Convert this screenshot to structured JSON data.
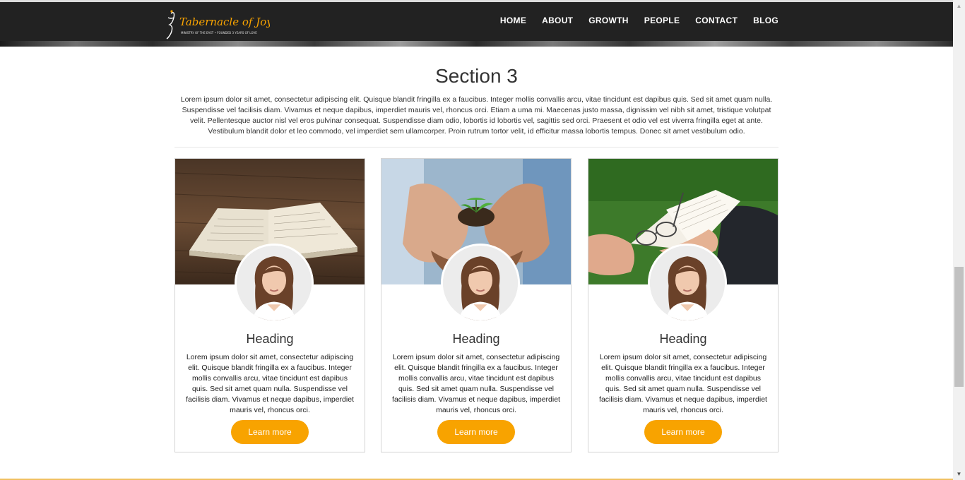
{
  "nav": {
    "logo_text": "Tabernacle of Joy",
    "logo_subtext": "Ministry of the East • Founded 3 years of love",
    "items": [
      "HOME",
      "ABOUT",
      "GROWTH",
      "PEOPLE",
      "CONTACT",
      "BLOG"
    ]
  },
  "section": {
    "title": "Section 3",
    "intro": "Lorem ipsum dolor sit amet, consectetur adipiscing elit. Quisque blandit fringilla ex a faucibus. Integer mollis convallis arcu, vitae tincidunt est dapibus quis. Sed sit amet quam nulla. Suspendisse vel facilisis diam. Vivamus et neque dapibus, imperdiet mauris vel, rhoncus orci. Etiam a uma mi. Maecenas justo massa, dignissim vel nibh sit amet, tristique volutpat velit. Pellentesque auctor nisl vel eros pulvinar consequat. Suspendisse diam odio, lobortis id lobortis vel, sagittis sed orci. Praesent et odio vel est viverra fringilla eget at ante. Vestibulum blandit dolor et leo commodo, vel imperdiet sem ullamcorper. Proin rutrum tortor velit, id efficitur massa lobortis tempus. Donec sit amet vestibulum odio."
  },
  "cards": [
    {
      "image": "open-bible-on-wood-photo",
      "heading": "Heading",
      "text": "Lorem ipsum dolor sit amet, consectetur adipiscing elit. Quisque blandit fringilla ex a faucibus. Integer mollis convallis arcu, vitae tincidunt est dapibus quis. Sed sit amet quam nulla. Suspendisse vel facilisis diam. Vivamus et neque dapibus, imperdiet mauris vel, rhoncus orci.",
      "button": "Learn more"
    },
    {
      "image": "hands-holding-seedling-photo",
      "heading": "Heading",
      "text": "Lorem ipsum dolor sit amet, consectetur adipiscing elit. Quisque blandit fringilla ex a faucibus. Integer mollis convallis arcu, vitae tincidunt est dapibus quis. Sed sit amet quam nulla. Suspendisse vel facilisis diam. Vivamus et neque dapibus, imperdiet mauris vel, rhoncus orci.",
      "button": "Learn more"
    },
    {
      "image": "bible-and-glasses-on-grass-photo",
      "heading": "Heading",
      "text": "Lorem ipsum dolor sit amet, consectetur adipiscing elit. Quisque blandit fringilla ex a faucibus. Integer mollis convallis arcu, vitae tincidunt est dapibus quis. Sed sit amet quam nulla. Suspendisse vel facilisis diam. Vivamus et neque dapibus, imperdiet mauris vel, rhoncus orci.",
      "button": "Learn more"
    }
  ],
  "colors": {
    "navbar": "#222222",
    "accent": "#f8a300",
    "text": "#333333"
  },
  "icons": {
    "scroll_up": "scroll-up-arrow-icon",
    "scroll_down": "scroll-down-arrow-icon"
  }
}
